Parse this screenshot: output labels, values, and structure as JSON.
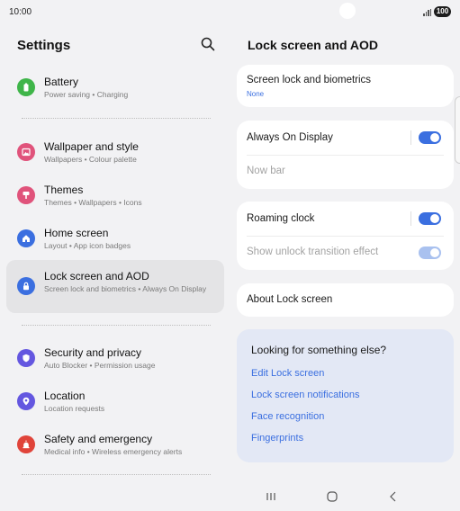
{
  "status_bar": {
    "time": "10:00",
    "battery": "100"
  },
  "left": {
    "title": "Settings",
    "items": [
      {
        "title": "Battery",
        "subtitle": "Power saving • Charging",
        "icon": "battery-icon",
        "color": "#3fb549"
      },
      {
        "title": "Wallpaper and style",
        "subtitle": "Wallpapers • Colour palette",
        "icon": "wallpaper-icon",
        "color": "#e0537b"
      },
      {
        "title": "Themes",
        "subtitle": "Themes • Wallpapers • Icons",
        "icon": "themes-icon",
        "color": "#e0537b"
      },
      {
        "title": "Home screen",
        "subtitle": "Layout • App icon badges",
        "icon": "home-icon",
        "color": "#3b6fe0"
      },
      {
        "title": "Lock screen and AOD",
        "subtitle": "Screen lock and biometrics • Always On Display",
        "icon": "lock-icon",
        "color": "#3b6fe0"
      },
      {
        "title": "Security and privacy",
        "subtitle": "Auto Blocker • Permission usage",
        "icon": "shield-icon",
        "color": "#6457e0"
      },
      {
        "title": "Location",
        "subtitle": "Location requests",
        "icon": "location-pin-icon",
        "color": "#6457e0"
      },
      {
        "title": "Safety and emergency",
        "subtitle": "Medical info • Wireless emergency alerts",
        "icon": "emergency-icon",
        "color": "#e0443a"
      }
    ]
  },
  "right": {
    "title": "Lock screen and AOD",
    "screen_lock": {
      "title": "Screen lock and biometrics",
      "value": "None"
    },
    "aod": {
      "title": "Always On Display",
      "enabled": true
    },
    "now_bar": {
      "title": "Now bar"
    },
    "roaming_clock": {
      "title": "Roaming clock",
      "enabled": true
    },
    "unlock_effect": {
      "title": "Show unlock transition effect",
      "enabled": true,
      "disabled": true
    },
    "about": {
      "title": "About Lock screen"
    },
    "suggest": {
      "title": "Looking for something else?",
      "links": [
        "Edit Lock screen",
        "Lock screen notifications",
        "Face recognition",
        "Fingerprints"
      ]
    }
  },
  "colors": {
    "accent": "#3b6fe0",
    "selected_bg": "#e4e4e6",
    "suggest_bg": "#e3e8f5"
  }
}
